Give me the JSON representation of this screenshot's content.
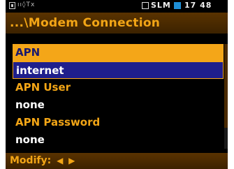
{
  "status_bar": {
    "battery_icon": "battery-icon",
    "signal_icons": "ıı◊Tx",
    "slm_label": "SLM",
    "time": "17 48"
  },
  "title": "...\\Modem Connection",
  "rows": [
    {
      "type": "label",
      "text": "APN"
    },
    {
      "type": "value",
      "text": "internet"
    },
    {
      "type": "label",
      "text": "APN User"
    },
    {
      "type": "value",
      "text": "none"
    },
    {
      "type": "label",
      "text": "APN Password"
    },
    {
      "type": "value",
      "text": "none"
    }
  ],
  "footer": {
    "label": "Modify:",
    "left_arrow": "◀",
    "right_arrow": "▶"
  },
  "colors": {
    "accent": "#f4a618",
    "selection": "#1f1f8c",
    "header_bg": "#4a2a00",
    "status_indicator": "#1f8fd6"
  }
}
